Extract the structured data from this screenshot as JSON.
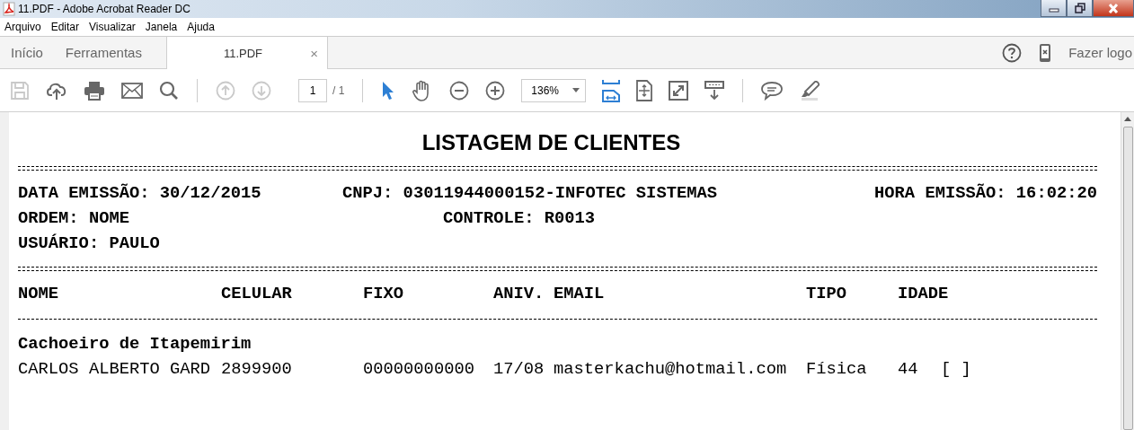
{
  "window": {
    "title": "11.PDF - Adobe Acrobat Reader DC"
  },
  "menu": [
    "Arquivo",
    "Editar",
    "Visualizar",
    "Janela",
    "Ajuda"
  ],
  "tabs": [
    {
      "label": "Início",
      "selected": false,
      "kind": "nav"
    },
    {
      "label": "Ferramentas",
      "selected": false,
      "kind": "nav"
    },
    {
      "label": "11.PDF",
      "selected": true,
      "kind": "document",
      "close": "×"
    }
  ],
  "account": {
    "label": "Fazer logo"
  },
  "toolbar": {
    "save": {
      "disabled": true
    },
    "previous_page": {
      "disabled": true
    },
    "next_page": {
      "disabled": true
    },
    "page_number": "1",
    "page_count": "/ 1",
    "select_tool": {
      "selected": true
    },
    "hand_tool": {
      "selected": false
    },
    "zoom": "136%",
    "fit_width": {
      "selected": true
    }
  },
  "report": {
    "title": "LISTAGEM DE CLIENTES",
    "meta_rows": [
      [
        "DATA EMISSÃO: 30/12/2015",
        "CNPJ: 03011944000152-INFOTEC SISTEMAS",
        "HORA EMISSÃO: 16:02:20"
      ],
      [
        "ORDEM: NOME",
        "CONTROLE: R0013"
      ],
      [
        "USUÁRIO: PAULO"
      ]
    ],
    "columns": [
      "NOME",
      "CELULAR",
      "FIXO",
      "ANIV.",
      "EMAIL",
      "TIPO",
      "IDADE"
    ],
    "groups": [
      {
        "name": "Cachoeiro de Itapemirim",
        "rows": [
          [
            "CARLOS ALBERTO GARD",
            "2899900",
            "00000000000",
            "17/08",
            "masterkachu@hotmail.com",
            "Física",
            "44",
            "[ ]"
          ]
        ]
      }
    ]
  }
}
